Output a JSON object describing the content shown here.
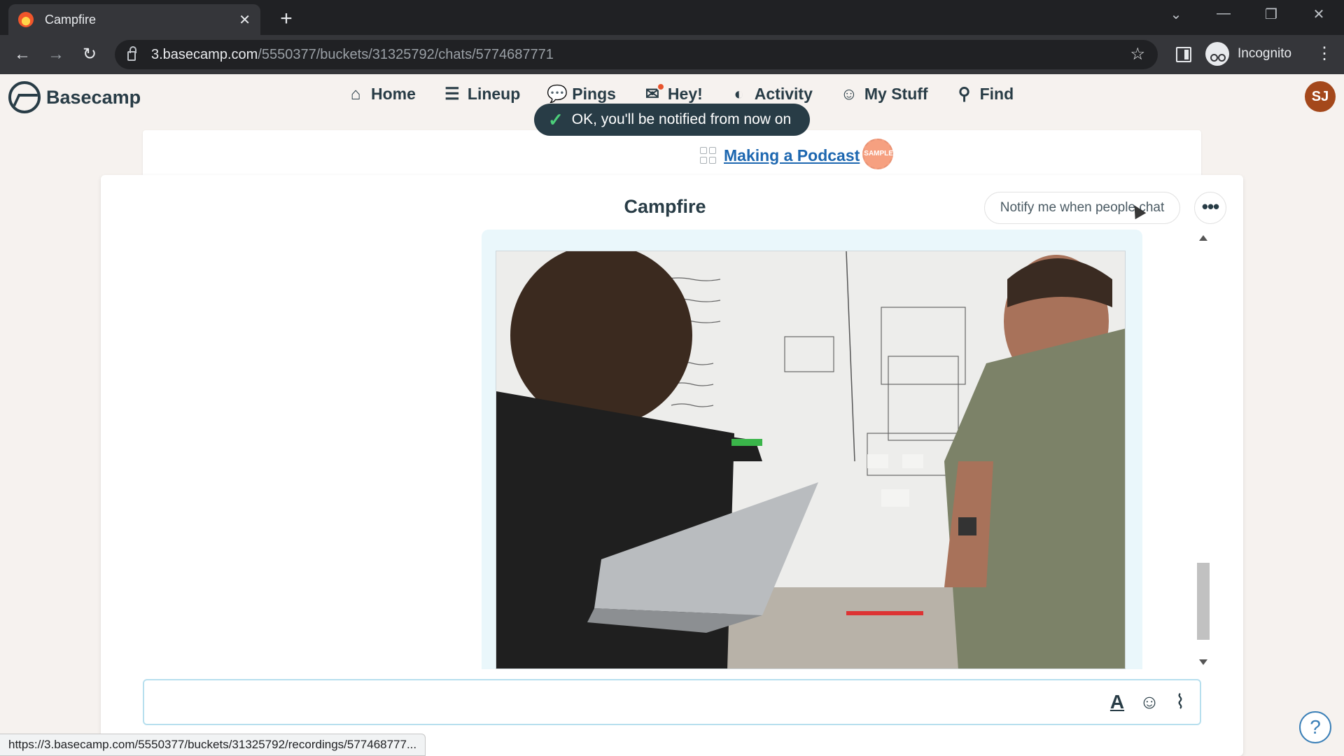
{
  "browser": {
    "tab_title": "Campfire",
    "tab_close": "✕",
    "new_tab": "+",
    "url_host": "3.basecamp.com",
    "url_path": "/5550377/buckets/31325792/chats/5774687771",
    "profile_label": "Incognito",
    "status_url": "https://3.basecamp.com/5550377/buckets/31325792/recordings/577468777..."
  },
  "nav": {
    "brand": "Basecamp",
    "items": [
      {
        "label": "Home",
        "icon": "home-icon",
        "glyph": "⌂"
      },
      {
        "label": "Lineup",
        "icon": "lineup-icon",
        "glyph": "☰"
      },
      {
        "label": "Pings",
        "icon": "pings-icon",
        "glyph": "💬"
      },
      {
        "label": "Hey!",
        "icon": "hey-icon",
        "glyph": "✉"
      },
      {
        "label": "Activity",
        "icon": "activity-icon",
        "glyph": "◐"
      },
      {
        "label": "My Stuff",
        "icon": "my-stuff-icon",
        "glyph": "☺"
      },
      {
        "label": "Find",
        "icon": "search-icon",
        "glyph": "⚲"
      }
    ],
    "avatar_initials": "SJ",
    "avatar_color": "#a4481b",
    "notification_dot_color": "#e8542d"
  },
  "toast": {
    "message": "OK, you'll be notified from now on"
  },
  "project": {
    "name": "Making a Podcast",
    "badge": "SAMPLE"
  },
  "campfire": {
    "title": "Campfire",
    "notify_button": "Notify me when people chat",
    "more_button": "•••"
  },
  "composer": {
    "value": "",
    "placeholder": ""
  },
  "colors": {
    "link": "#1d67b0",
    "text": "#283c46",
    "bubble": "#eaf7fb",
    "composer_border": "#b7dfee"
  }
}
